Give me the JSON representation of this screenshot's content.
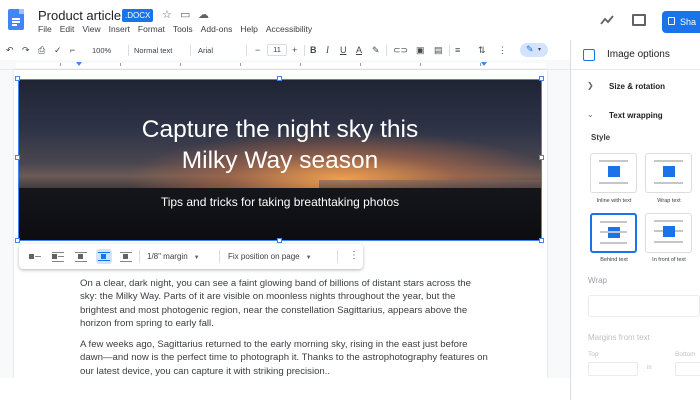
{
  "app": {
    "title": "Product article",
    "badge": ".DOCX",
    "menu": [
      "File",
      "Edit",
      "View",
      "Insert",
      "Format",
      "Tools",
      "Add-ons",
      "Help",
      "Accessibility"
    ],
    "share_label": "Sha",
    "accent": "#1a73e8"
  },
  "toolbar": {
    "zoom": "100%",
    "style": "Normal text",
    "font": "Arial",
    "font_size": "11"
  },
  "hero": {
    "title_line1": "Capture the night sky this",
    "title_line2": "Milky Way season",
    "subtitle": "Tips and tricks for taking breathtaking photos"
  },
  "image_toolbar": {
    "margin": "1/8\" margin",
    "position": "Fix position on page"
  },
  "body": {
    "paragraph1": "On a clear, dark night, you can see a faint glowing band of billions of distant stars across the sky: the Milky Way. Parts of it are visible on moonless nights throughout the year, but the brightest and most photogenic region, near the constellation Sagittarius, appears above the horizon from spring to early fall.",
    "paragraph2": "A few weeks ago, Sagittarius returned to the early morning sky, rising in the east just before dawn—and now is the perfect time to photograph it. Thanks to the astrophotography features on our latest device, you can capture it with striking precision.."
  },
  "panel": {
    "title": "Image options",
    "size_rotation": "Size & rotation",
    "text_wrapping": "Text wrapping",
    "style_label": "Style",
    "options": [
      "Inline with text",
      "Wrap text",
      "Behind text",
      "In front of text"
    ],
    "wrap_label": "Wrap",
    "margins_label": "Margins from text",
    "top_label": "Top",
    "bottom_label": "Bottom",
    "unit": "in"
  }
}
